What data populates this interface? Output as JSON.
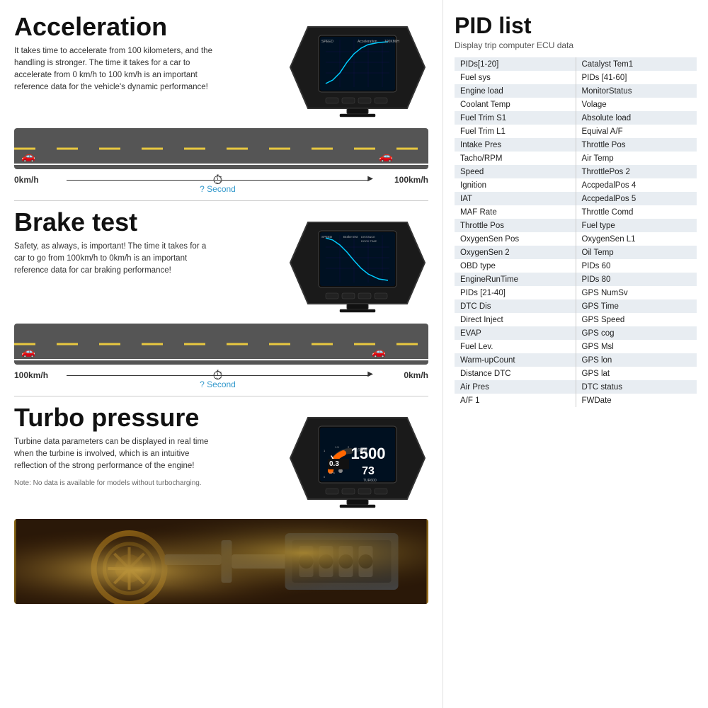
{
  "left": {
    "acceleration": {
      "title": "Acceleration",
      "description": "It takes time to accelerate from 100 kilometers, and the handling is stronger. The time it takes for a car to accelerate from 0 km/h to 100 km/h is an important reference data for the vehicle's dynamic performance!",
      "speed_start": "0km/h",
      "speed_end": "100km/h",
      "second_label": "? Second"
    },
    "brake": {
      "title": "Brake test",
      "description": "Safety, as always, is important! The time it takes for a car to go from 100km/h to 0km/h is an important reference data for car braking performance!",
      "speed_start": "100km/h",
      "speed_end": "0km/h",
      "second_label": "? Second"
    },
    "turbo": {
      "title": "Turbo pressure",
      "description": "Turbine data parameters can be displayed in real time when the turbine is involved, which is an intuitive reflection of the strong performance of the engine!",
      "note": "Note: No data is available for models without turbocharging."
    }
  },
  "right": {
    "title": "PID list",
    "subtitle": "Display trip computer ECU data",
    "table_rows": [
      [
        "PIDs[1-20]",
        "Catalyst Tem1"
      ],
      [
        "Fuel sys",
        "PIDs [41-60]"
      ],
      [
        "Engine load",
        "MonitorStatus"
      ],
      [
        "Coolant Temp",
        "Volage"
      ],
      [
        "Fuel Trim S1",
        "Absolute load"
      ],
      [
        "Fuel Trim L1",
        "Equival A/F"
      ],
      [
        "Intake Pres",
        "Throttle Pos"
      ],
      [
        "Tacho/RPM",
        "Air Temp"
      ],
      [
        "Speed",
        "ThrottlePos 2"
      ],
      [
        "Ignition",
        "AccpedalPos 4"
      ],
      [
        "IAT",
        "AccpedalPos 5"
      ],
      [
        "MAF Rate",
        "Throttle Comd"
      ],
      [
        "Throttle Pos",
        "Fuel type"
      ],
      [
        "OxygenSen Pos",
        "OxygenSen L1"
      ],
      [
        "OxygenSen 2",
        "Oil Temp"
      ],
      [
        "OBD type",
        "PIDs 60"
      ],
      [
        "EngineRunTime",
        "PIDs  80"
      ],
      [
        "PIDs [21-40]",
        "GPS NumSv"
      ],
      [
        "DTC Dis",
        "GPS Time"
      ],
      [
        "Direct Inject",
        "GPS Speed"
      ],
      [
        "EVAP",
        "GPS cog"
      ],
      [
        "Fuel Lev.",
        "GPS Msl"
      ],
      [
        "Warm-upCount",
        "GPS lon"
      ],
      [
        "Distance DTC",
        "GPS lat"
      ],
      [
        "Air Pres",
        "DTC status"
      ],
      [
        "A/F 1",
        "FWDate"
      ]
    ]
  }
}
